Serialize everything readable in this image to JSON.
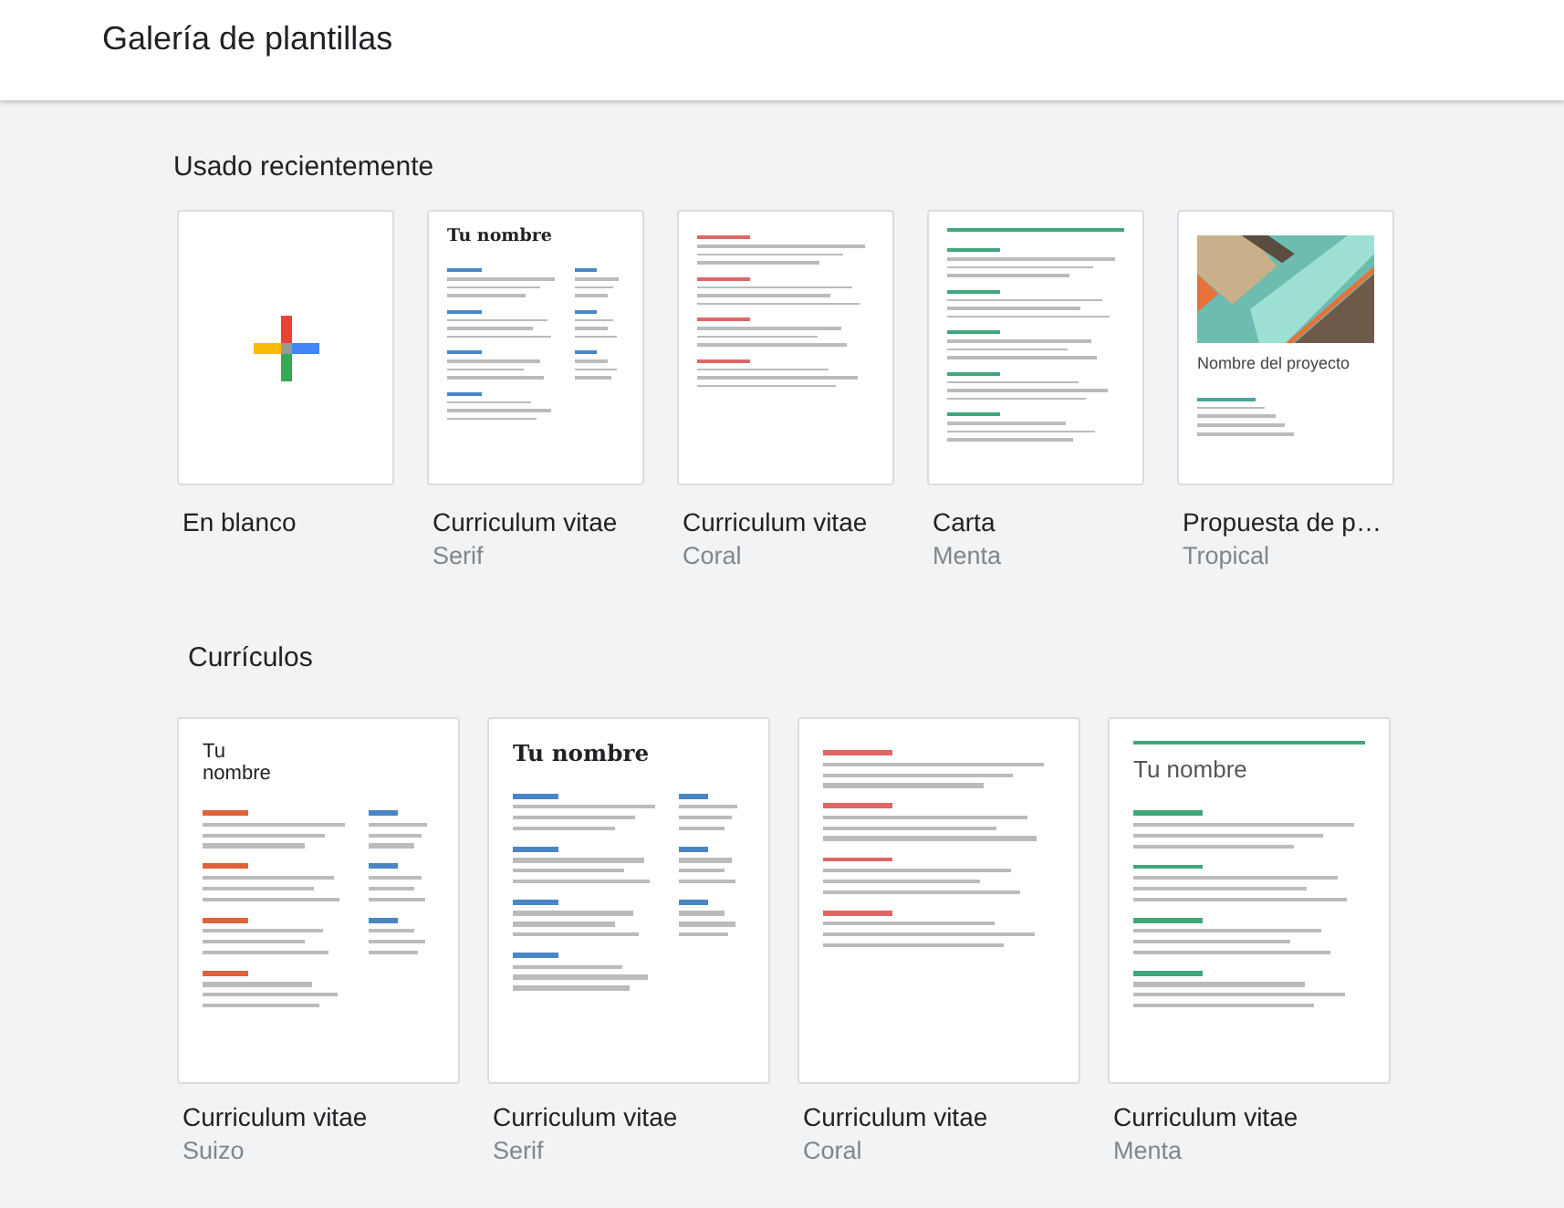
{
  "header": {
    "title": "Galería de plantillas"
  },
  "sections": [
    {
      "title": "Usado recientemente",
      "templates": [
        {
          "kind": "blank",
          "name": "En blanco"
        },
        {
          "kind": "serif",
          "name": "Curriculum vitae",
          "style": "Serif",
          "heading": "Tu nombre"
        },
        {
          "kind": "coral",
          "name": "Curriculum vitae",
          "style": "Coral"
        },
        {
          "kind": "carta",
          "name": "Carta",
          "style": "Menta"
        },
        {
          "kind": "tropical",
          "name": "Propuesta de p…",
          "style": "Tropical",
          "heading": "Nombre del proyecto"
        }
      ]
    },
    {
      "title": "Currículos",
      "templates": [
        {
          "kind": "suizo",
          "name": "Curriculum vitae",
          "style": "Suizo",
          "heading": "Tu nombre"
        },
        {
          "kind": "serif",
          "name": "Curriculum vitae",
          "style": "Serif",
          "heading": "Tu nombre"
        },
        {
          "kind": "coral",
          "name": "Curriculum vitae",
          "style": "Coral"
        },
        {
          "kind": "menta",
          "name": "Curriculum vitae",
          "style": "Menta",
          "heading": "Tu nombre"
        }
      ]
    }
  ]
}
